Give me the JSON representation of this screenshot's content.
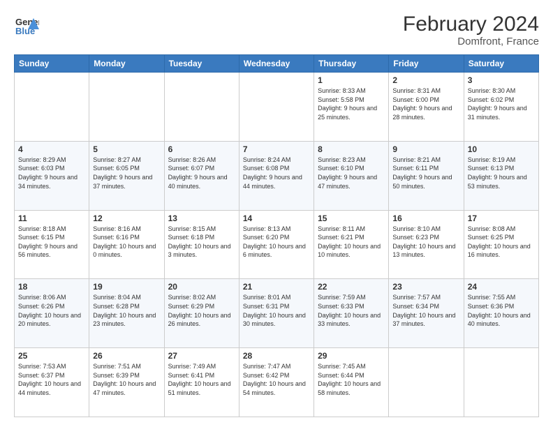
{
  "header": {
    "logo_line1": "General",
    "logo_line2": "Blue",
    "title": "February 2024",
    "subtitle": "Domfront, France"
  },
  "days_of_week": [
    "Sunday",
    "Monday",
    "Tuesday",
    "Wednesday",
    "Thursday",
    "Friday",
    "Saturday"
  ],
  "weeks": [
    [
      {
        "num": "",
        "info": ""
      },
      {
        "num": "",
        "info": ""
      },
      {
        "num": "",
        "info": ""
      },
      {
        "num": "",
        "info": ""
      },
      {
        "num": "1",
        "info": "Sunrise: 8:33 AM\nSunset: 5:58 PM\nDaylight: 9 hours\nand 25 minutes."
      },
      {
        "num": "2",
        "info": "Sunrise: 8:31 AM\nSunset: 6:00 PM\nDaylight: 9 hours\nand 28 minutes."
      },
      {
        "num": "3",
        "info": "Sunrise: 8:30 AM\nSunset: 6:02 PM\nDaylight: 9 hours\nand 31 minutes."
      }
    ],
    [
      {
        "num": "4",
        "info": "Sunrise: 8:29 AM\nSunset: 6:03 PM\nDaylight: 9 hours\nand 34 minutes."
      },
      {
        "num": "5",
        "info": "Sunrise: 8:27 AM\nSunset: 6:05 PM\nDaylight: 9 hours\nand 37 minutes."
      },
      {
        "num": "6",
        "info": "Sunrise: 8:26 AM\nSunset: 6:07 PM\nDaylight: 9 hours\nand 40 minutes."
      },
      {
        "num": "7",
        "info": "Sunrise: 8:24 AM\nSunset: 6:08 PM\nDaylight: 9 hours\nand 44 minutes."
      },
      {
        "num": "8",
        "info": "Sunrise: 8:23 AM\nSunset: 6:10 PM\nDaylight: 9 hours\nand 47 minutes."
      },
      {
        "num": "9",
        "info": "Sunrise: 8:21 AM\nSunset: 6:11 PM\nDaylight: 9 hours\nand 50 minutes."
      },
      {
        "num": "10",
        "info": "Sunrise: 8:19 AM\nSunset: 6:13 PM\nDaylight: 9 hours\nand 53 minutes."
      }
    ],
    [
      {
        "num": "11",
        "info": "Sunrise: 8:18 AM\nSunset: 6:15 PM\nDaylight: 9 hours\nand 56 minutes."
      },
      {
        "num": "12",
        "info": "Sunrise: 8:16 AM\nSunset: 6:16 PM\nDaylight: 10 hours\nand 0 minutes."
      },
      {
        "num": "13",
        "info": "Sunrise: 8:15 AM\nSunset: 6:18 PM\nDaylight: 10 hours\nand 3 minutes."
      },
      {
        "num": "14",
        "info": "Sunrise: 8:13 AM\nSunset: 6:20 PM\nDaylight: 10 hours\nand 6 minutes."
      },
      {
        "num": "15",
        "info": "Sunrise: 8:11 AM\nSunset: 6:21 PM\nDaylight: 10 hours\nand 10 minutes."
      },
      {
        "num": "16",
        "info": "Sunrise: 8:10 AM\nSunset: 6:23 PM\nDaylight: 10 hours\nand 13 minutes."
      },
      {
        "num": "17",
        "info": "Sunrise: 8:08 AM\nSunset: 6:25 PM\nDaylight: 10 hours\nand 16 minutes."
      }
    ],
    [
      {
        "num": "18",
        "info": "Sunrise: 8:06 AM\nSunset: 6:26 PM\nDaylight: 10 hours\nand 20 minutes."
      },
      {
        "num": "19",
        "info": "Sunrise: 8:04 AM\nSunset: 6:28 PM\nDaylight: 10 hours\nand 23 minutes."
      },
      {
        "num": "20",
        "info": "Sunrise: 8:02 AM\nSunset: 6:29 PM\nDaylight: 10 hours\nand 26 minutes."
      },
      {
        "num": "21",
        "info": "Sunrise: 8:01 AM\nSunset: 6:31 PM\nDaylight: 10 hours\nand 30 minutes."
      },
      {
        "num": "22",
        "info": "Sunrise: 7:59 AM\nSunset: 6:33 PM\nDaylight: 10 hours\nand 33 minutes."
      },
      {
        "num": "23",
        "info": "Sunrise: 7:57 AM\nSunset: 6:34 PM\nDaylight: 10 hours\nand 37 minutes."
      },
      {
        "num": "24",
        "info": "Sunrise: 7:55 AM\nSunset: 6:36 PM\nDaylight: 10 hours\nand 40 minutes."
      }
    ],
    [
      {
        "num": "25",
        "info": "Sunrise: 7:53 AM\nSunset: 6:37 PM\nDaylight: 10 hours\nand 44 minutes."
      },
      {
        "num": "26",
        "info": "Sunrise: 7:51 AM\nSunset: 6:39 PM\nDaylight: 10 hours\nand 47 minutes."
      },
      {
        "num": "27",
        "info": "Sunrise: 7:49 AM\nSunset: 6:41 PM\nDaylight: 10 hours\nand 51 minutes."
      },
      {
        "num": "28",
        "info": "Sunrise: 7:47 AM\nSunset: 6:42 PM\nDaylight: 10 hours\nand 54 minutes."
      },
      {
        "num": "29",
        "info": "Sunrise: 7:45 AM\nSunset: 6:44 PM\nDaylight: 10 hours\nand 58 minutes."
      },
      {
        "num": "",
        "info": ""
      },
      {
        "num": "",
        "info": ""
      }
    ]
  ],
  "colors": {
    "header_bg": "#3a7abf",
    "header_text": "#ffffff",
    "border": "#cccccc",
    "accent": "#4a90d9"
  }
}
